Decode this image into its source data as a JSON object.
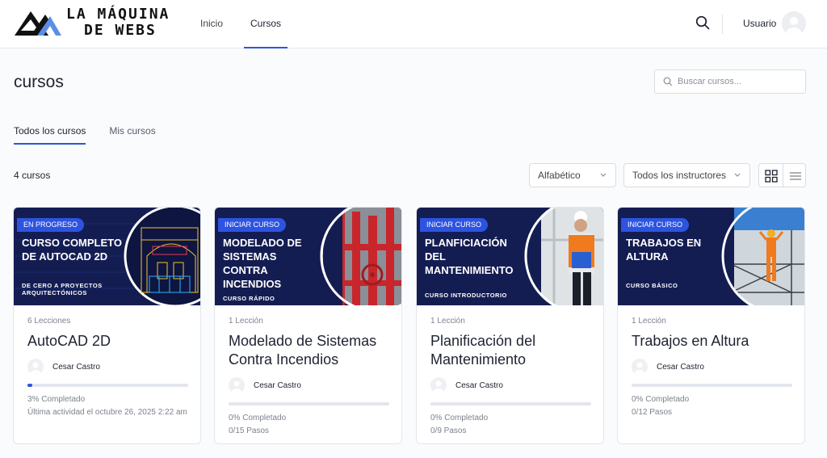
{
  "header": {
    "logo_line1": "LA MÁQUINA",
    "logo_line2": "DE WEBS",
    "nav": [
      {
        "label": "Inicio"
      },
      {
        "label": "Cursos"
      }
    ],
    "user_name": "Usuario"
  },
  "page": {
    "title": "cursos",
    "search_placeholder": "Buscar cursos..."
  },
  "tabs": [
    {
      "label": "Todos los cursos"
    },
    {
      "label": "Mis cursos"
    }
  ],
  "toolbar": {
    "count": "4 cursos",
    "sort_value": "Alfabético",
    "instructor_value": "Todos los instructores"
  },
  "colors": {
    "accent": "#2b59d6",
    "thumb_bg": "#141d52",
    "ribbon": "#2d54e0"
  },
  "courses": [
    {
      "ribbon": "EN PROGRESO",
      "thumb_title": "CURSO COMPLETO DE AUTOCAD 2D",
      "thumb_sub": "DE CERO A PROYECTOS ARQUITECTÓNICOS",
      "lessons": "6 Lecciones",
      "title": "AutoCAD 2D",
      "instructor": "Cesar Castro",
      "progress": 3,
      "completed": "3% Completado",
      "meta": "Última actividad el octubre 26, 2025 2:22 am"
    },
    {
      "ribbon": "INICIAR CURSO",
      "thumb_title": "MODELADO DE SISTEMAS CONTRA INCENDIOS",
      "thumb_sub": "CURSO RÁPIDO",
      "lessons": "1 Lección",
      "title": "Modelado de Sistemas Contra Incendios",
      "instructor": "Cesar Castro",
      "progress": 0,
      "completed": "0% Completado",
      "meta": "0/15 Pasos"
    },
    {
      "ribbon": "INICIAR CURSO",
      "thumb_title": "PLANFICIACIÓN DEL MANTENIMIENTO",
      "thumb_sub": "CURSO INTRODUCTORIO",
      "lessons": "1 Lección",
      "title": "Planificación del Mantenimiento",
      "instructor": "Cesar Castro",
      "progress": 0,
      "completed": "0% Completado",
      "meta": "0/9 Pasos"
    },
    {
      "ribbon": "INICIAR CURSO",
      "thumb_title": "TRABAJOS EN ALTURA",
      "thumb_sub": "CURSO BÁSICO",
      "lessons": "1 Lección",
      "title": "Trabajos en Altura",
      "instructor": "Cesar Castro",
      "progress": 0,
      "completed": "0% Completado",
      "meta": "0/12 Pasos"
    }
  ]
}
